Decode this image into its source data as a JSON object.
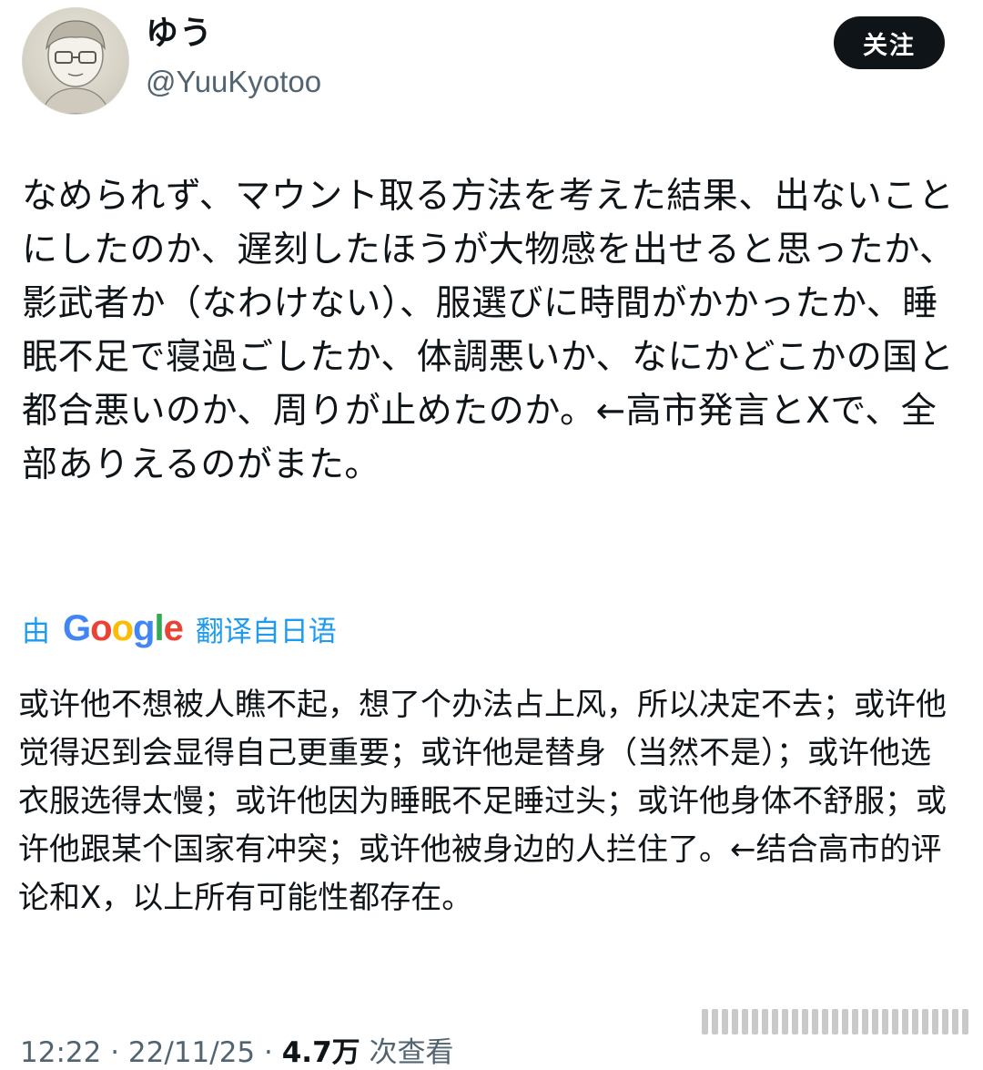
{
  "user": {
    "display_name": "ゆう",
    "handle": "@YuuKyotoo"
  },
  "follow_button": {
    "label": "关注"
  },
  "post": {
    "original_text": "なめられず、マウント取る方法を考えた結果、出ないことにしたのか、遅刻したほうが大物感を出せると思ったか、影武者か（なわけない）、服選びに時間がかかったか、睡眠不足で寝過ごしたか、体調悪いか、なにかどこかの国と都合悪いのか、周りが止めたのか。←高市発言とXで、全部ありえるのがまた。",
    "translate_prefix": "由",
    "translate_brand": "Google",
    "translate_suffix": "翻译自日语",
    "translated_text": "或许他不想被人瞧不起，想了个办法占上风，所以决定不去；或许他觉得迟到会显得自己更重要；或许他是替身（当然不是）；或许他选衣服选得太慢；或许他因为睡眠不足睡过头；或许他身体不舒服；或许他跟某个国家有冲突；或许他被身边的人拦住了。←结合高市的评论和X，以上所有可能性都存在。"
  },
  "meta": {
    "time": "12:22",
    "date": "22/11/25",
    "views_count": "4.7万",
    "views_label": "次查看"
  },
  "colors": {
    "link": "#1d9bf0",
    "button_bg": "#0f1419",
    "secondary_text": "#536471"
  }
}
